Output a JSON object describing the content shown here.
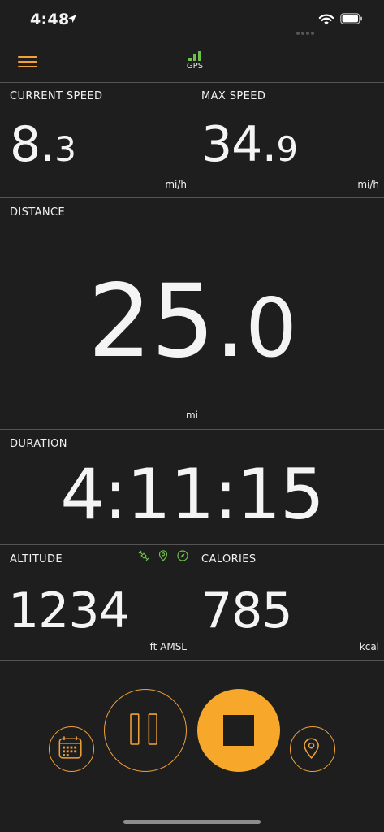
{
  "status": {
    "time": "4:48"
  },
  "nav": {
    "gps_label": "GPS"
  },
  "current_speed": {
    "title": "CURRENT SPEED",
    "int": "8.",
    "frac": "3",
    "unit": "mi/h"
  },
  "max_speed": {
    "title": "MAX SPEED",
    "int": "34.",
    "frac": "9",
    "unit": "mi/h"
  },
  "distance": {
    "title": "DISTANCE",
    "int": "25.",
    "frac": "0",
    "unit": "mi"
  },
  "duration": {
    "title": "DURATION",
    "value": "4:11:15"
  },
  "altitude": {
    "title": "ALTITUDE",
    "value": "1234",
    "unit": "ft AMSL"
  },
  "calories": {
    "title": "CALORIES",
    "value": "785",
    "unit": "kcal"
  },
  "colors": {
    "accent": "#f7a82a",
    "gps_green": "#6fc04a",
    "background": "#1e1e1e",
    "divider": "#555555"
  },
  "icons": [
    "location-arrow-icon",
    "wifi-icon",
    "battery-icon",
    "menu-icon",
    "gps-signal-icon",
    "satellite-icon",
    "map-pin-icon",
    "compass-icon",
    "calendar-icon",
    "pause-icon",
    "stop-icon",
    "location-pin-icon"
  ]
}
